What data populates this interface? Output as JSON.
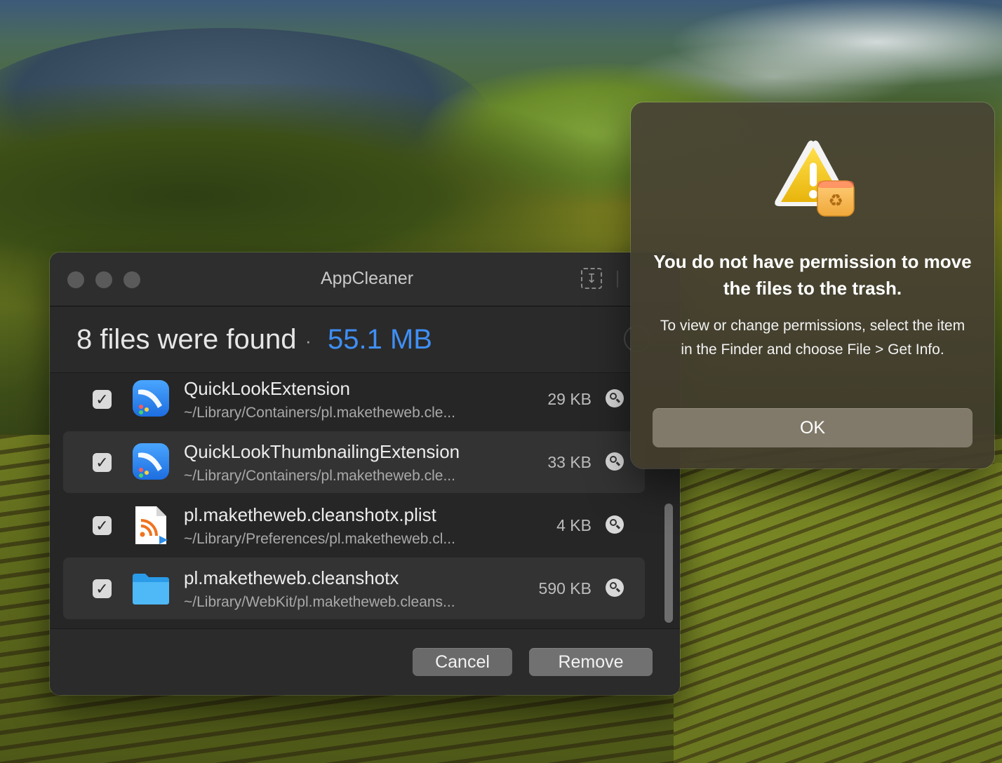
{
  "window": {
    "title": "AppCleaner",
    "download_icon": "download-tray-icon"
  },
  "summary": {
    "count_text": "8 files were found",
    "separator": "·",
    "total_size": "55.1 MB"
  },
  "files": [
    {
      "name": "QuickLookExtension",
      "path": "~/Library/Containers/pl.maketheweb.cle...",
      "size": "29 KB",
      "checked": true,
      "icon": "quicklook-extension-icon"
    },
    {
      "name": "QuickLookThumbnailingExtension",
      "path": "~/Library/Containers/pl.maketheweb.cle...",
      "size": "33 KB",
      "checked": true,
      "icon": "quicklook-extension-icon"
    },
    {
      "name": "pl.maketheweb.cleanshotx.plist",
      "path": "~/Library/Preferences/pl.maketheweb.cl...",
      "size": "4 KB",
      "checked": true,
      "icon": "plist-file-icon"
    },
    {
      "name": "pl.maketheweb.cleanshotx",
      "path": "~/Library/WebKit/pl.maketheweb.cleans...",
      "size": "590 KB",
      "checked": true,
      "icon": "folder-icon"
    }
  ],
  "footer": {
    "cancel_label": "Cancel",
    "remove_label": "Remove"
  },
  "alert": {
    "icon": "warning-trash-icon",
    "title": "You do not have permission to move the files to the trash.",
    "message": "To view or change permissions, select the item in the Finder and choose File > Get Info.",
    "ok_label": "OK"
  },
  "colors": {
    "accent": "#3f8ff5",
    "window_bg": "#262626",
    "warning_yellow": "#f2c718"
  }
}
